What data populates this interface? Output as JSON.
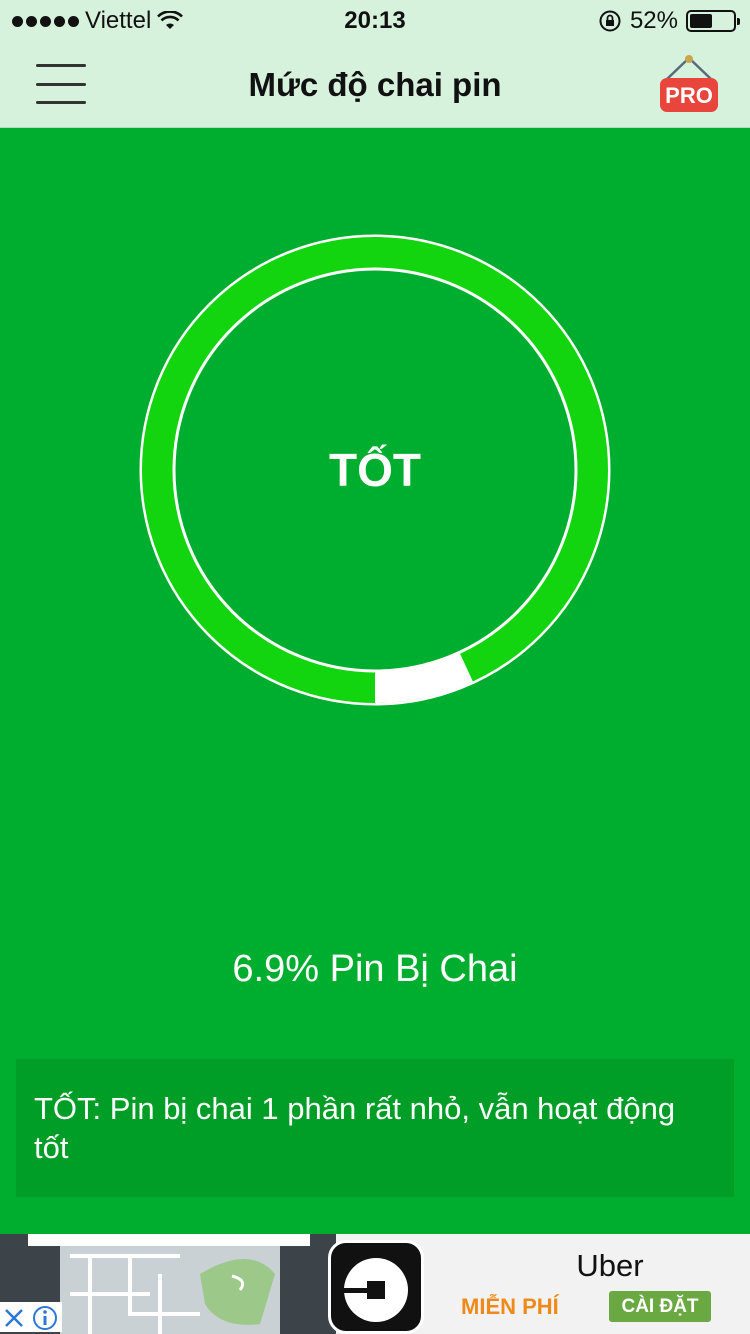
{
  "status_bar": {
    "carrier": "Viettel",
    "time": "20:13",
    "battery_percent": "52%",
    "battery_level": 0.52,
    "icons": [
      "signal-dots-icon",
      "wifi-icon",
      "rotation-lock-icon",
      "battery-icon"
    ]
  },
  "nav": {
    "title": "Mức độ chai pin",
    "menu_icon": "hamburger-menu-icon",
    "pro_label": "PRO"
  },
  "gauge": {
    "label": "TỐT",
    "worn_fraction": 0.069,
    "colors": {
      "background": "#00ae2f",
      "ring": "#12d40f",
      "worn": "#ffffff"
    }
  },
  "summary": {
    "percent_text": "6.9% Pin Bị Chai",
    "description": "TỐT: Pin bị chai 1 phần rất nhỏ, vẫn hoạt động tốt"
  },
  "ad": {
    "app_name": "Uber",
    "price_label": "MIỄN PHÍ",
    "install_label": "CÀI ĐẶT",
    "accent_orange": "#ef8a1a",
    "accent_green": "#6aa842"
  }
}
